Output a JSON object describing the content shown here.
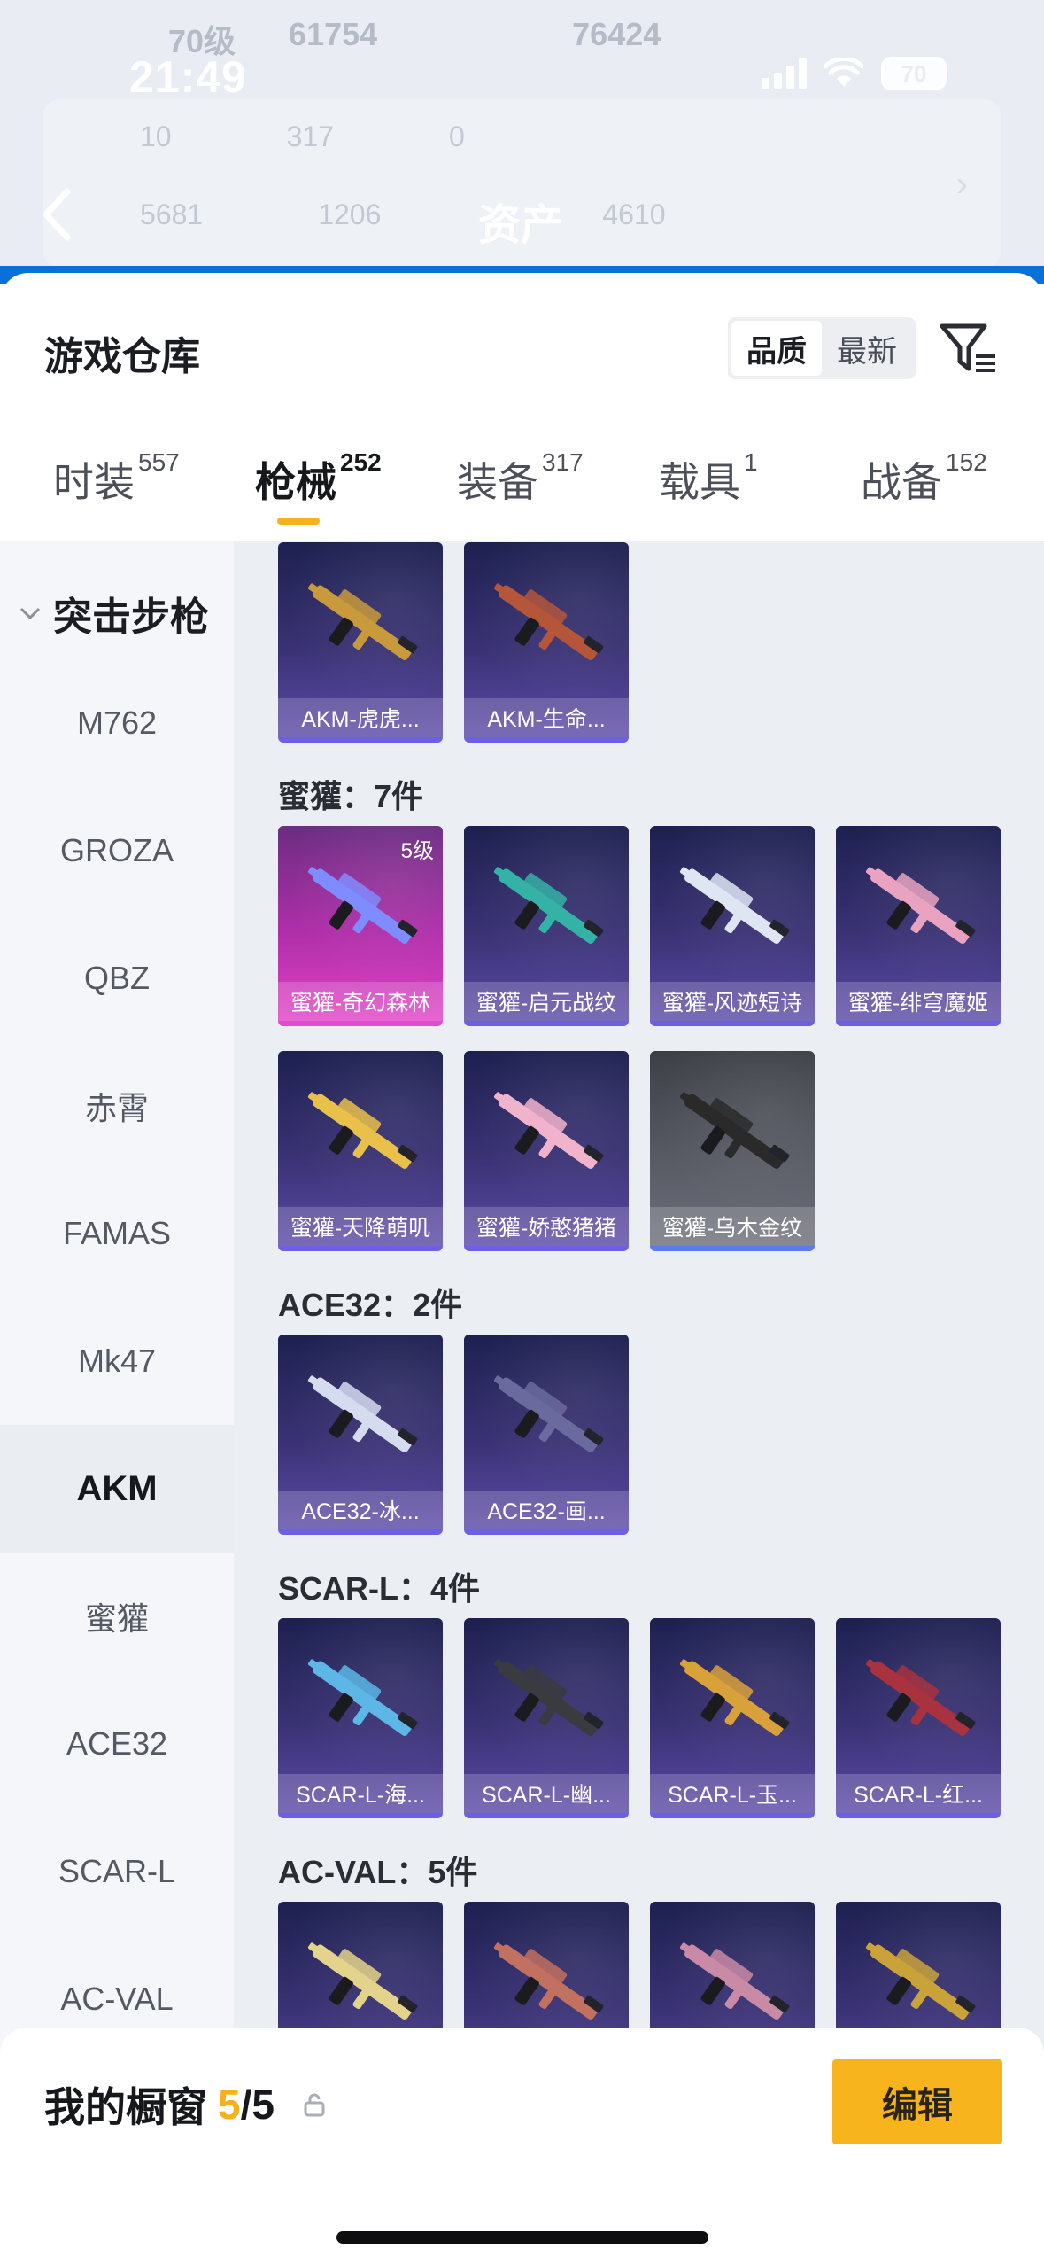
{
  "status_bar": {
    "time": "21:49",
    "battery": "70"
  },
  "background_page": {
    "title": "资产",
    "row1": [
      "70级",
      "61754",
      "76424"
    ],
    "row2": [
      "10",
      "317",
      "0"
    ],
    "row3": [
      "5681",
      "1206",
      "4610"
    ]
  },
  "sheet": {
    "title": "游戏仓库",
    "sort": [
      "品质",
      "最新"
    ],
    "tabs": [
      {
        "label": "时装",
        "count": "557"
      },
      {
        "label": "枪械",
        "count": "252"
      },
      {
        "label": "装备",
        "count": "317"
      },
      {
        "label": "载具",
        "count": "1"
      },
      {
        "label": "战备",
        "count": "152"
      }
    ],
    "active_tab": "枪械"
  },
  "sidebar": {
    "category": "突击步枪",
    "items": [
      "M762",
      "GROZA",
      "QBZ",
      "赤霄",
      "FAMAS",
      "Mk47",
      "AKM",
      "蜜獾",
      "ACE32",
      "SCAR-L",
      "AC-VAL"
    ],
    "active": "AKM"
  },
  "groups": [
    {
      "title": "",
      "items": [
        {
          "name": "AKM-虎虎...",
          "color": "#c89a3c"
        },
        {
          "name": "AKM-生命...",
          "color": "#b5563a"
        }
      ]
    },
    {
      "title": "蜜獾：7件",
      "items": [
        {
          "name": "蜜獾-奇幻森林",
          "level": "5级",
          "rarity": "purple",
          "color": "#7f8cff"
        },
        {
          "name": "蜜獾-启元战纹",
          "color": "#35b2a6"
        },
        {
          "name": "蜜獾-风迹短诗",
          "color": "#dfe6f3"
        },
        {
          "name": "蜜獾-绯穹魔姬",
          "color": "#e9a3c0"
        },
        {
          "name": "蜜獾-天降萌叽",
          "color": "#e9c14a"
        },
        {
          "name": "蜜獾-娇憨猪猪",
          "color": "#f1b3cc"
        },
        {
          "name": "蜜獾-乌木金纹",
          "rarity": "grey",
          "color": "#2a2a2a"
        }
      ]
    },
    {
      "title": "ACE32：2件",
      "items": [
        {
          "name": "ACE32-冰...",
          "color": "#d6dcef"
        },
        {
          "name": "ACE32-画...",
          "color": "#6b6a9e"
        }
      ]
    },
    {
      "title": "SCAR-L：4件",
      "items": [
        {
          "name": "SCAR-L-海...",
          "color": "#5cb6e6"
        },
        {
          "name": "SCAR-L-幽...",
          "color": "#3a3b40"
        },
        {
          "name": "SCAR-L-玉...",
          "color": "#d9a13a"
        },
        {
          "name": "SCAR-L-红...",
          "color": "#a8323e"
        }
      ]
    },
    {
      "title": "AC-VAL：5件",
      "items": [
        {
          "name": "",
          "color": "#e4d38a"
        },
        {
          "name": "",
          "color": "#c27060"
        },
        {
          "name": "",
          "color": "#c98aa6"
        },
        {
          "name": "",
          "color": "#c9a33a"
        }
      ]
    }
  ],
  "bottom": {
    "title": "我的橱窗",
    "count": "5",
    "total": "/5",
    "edit": "编辑"
  },
  "icons": {
    "filter": "filter-list-icon",
    "share": "share-export-icon",
    "lock": "lock-icon",
    "back": "chevron-left-icon"
  }
}
